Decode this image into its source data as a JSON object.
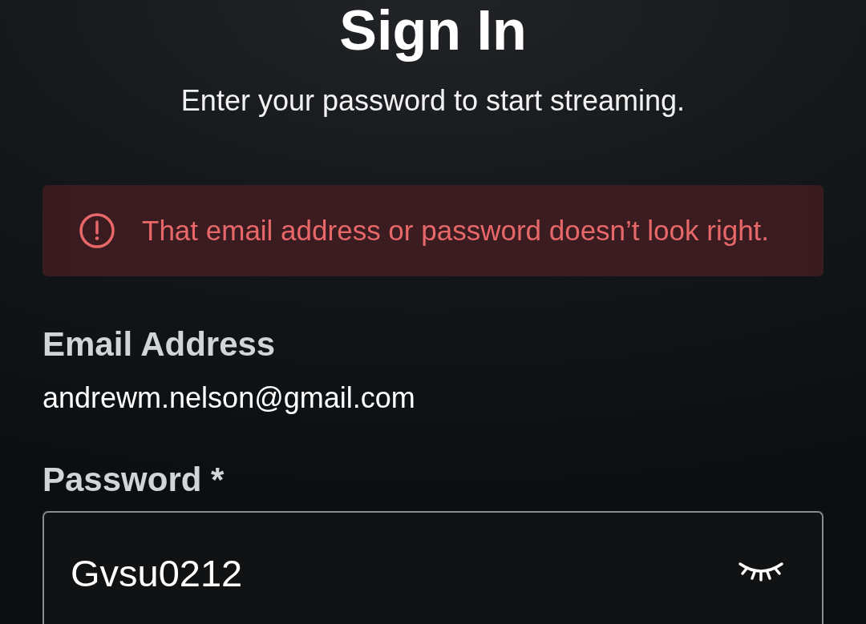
{
  "header": {
    "title": "Sign In",
    "subtitle": "Enter your password to start streaming."
  },
  "error_banner": {
    "message": "That email address or password doesn’t look right."
  },
  "email": {
    "label": "Email Address",
    "value": "andrewm.nelson@gmail.com"
  },
  "password": {
    "label": "Password *",
    "value": "Gvsu0212",
    "revealed": true
  }
}
